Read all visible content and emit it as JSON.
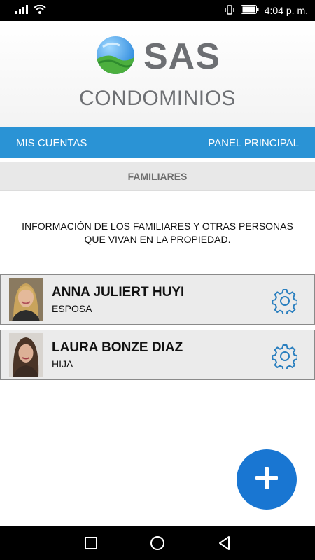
{
  "status_bar": {
    "time": "4:04 p. m.",
    "icons": [
      "signal-icon",
      "wifi-icon",
      "vibrate-icon",
      "battery-icon"
    ]
  },
  "header": {
    "logo_text": "SAS",
    "subtitle": "CONDOMINIOS"
  },
  "nav": {
    "left_label": "MIS CUENTAS",
    "right_label": "PANEL PRINCIPAL"
  },
  "section": {
    "title": "FAMILIARES"
  },
  "intro_text": "INFORMACIÓN DE LOS FAMILIARES Y OTRAS PERSONAS QUE VIVAN EN LA PROPIEDAD.",
  "family": [
    {
      "name": "ANNA JULIERT HUYI",
      "relation": "ESPOSA",
      "icon": "gear-icon"
    },
    {
      "name": "LAURA BONZE DIAZ",
      "relation": "HIJA",
      "icon": "gear-icon"
    }
  ],
  "fab": {
    "icon": "plus-icon"
  },
  "system_nav": {
    "icons": [
      "recent-apps-icon",
      "home-icon",
      "back-icon"
    ]
  },
  "colors": {
    "accent": "#2a93d5",
    "fab": "#1976d2",
    "gear": "#2a7fbf",
    "logo_gray": "#6d6f73"
  }
}
